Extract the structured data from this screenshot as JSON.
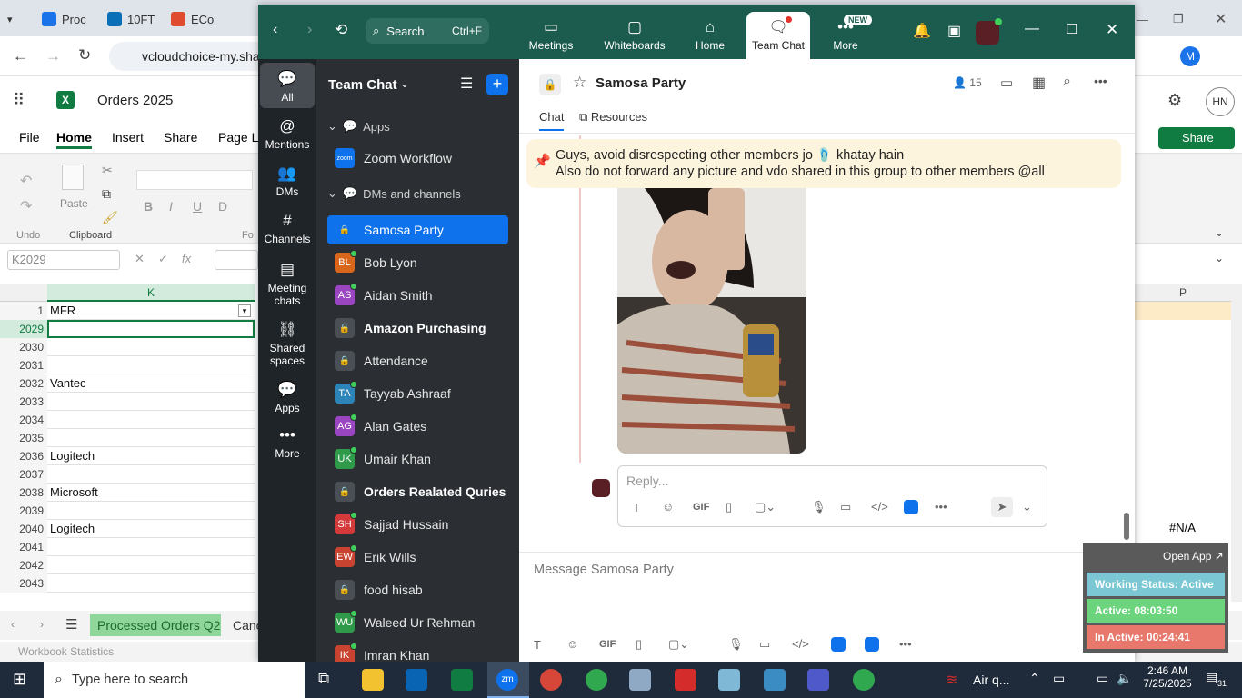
{
  "browser": {
    "tabs": [
      "Proc",
      "10FT",
      "ECo"
    ],
    "address": "vcloudchoice-my.sha"
  },
  "excel": {
    "title": "Orders 2025",
    "menu": [
      "File",
      "Home",
      "Insert",
      "Share",
      "Page La"
    ],
    "share_label": "Share",
    "ribbon": {
      "undo": "Undo",
      "paste": "Paste",
      "clipboard": "Clipboard",
      "font_partial": "Fo"
    },
    "name_box": "K2029",
    "col_k": "K",
    "col_p": "P",
    "header_row_num": "1",
    "header_cell": "MFR",
    "rows": [
      {
        "num": "2029",
        "k": ""
      },
      {
        "num": "2030",
        "k": ""
      },
      {
        "num": "2031",
        "k": ""
      },
      {
        "num": "2032",
        "k": "Vantec"
      },
      {
        "num": "2033",
        "k": ""
      },
      {
        "num": "2034",
        "k": ""
      },
      {
        "num": "2035",
        "k": ""
      },
      {
        "num": "2036",
        "k": "Logitech"
      },
      {
        "num": "2037",
        "k": ""
      },
      {
        "num": "2038",
        "k": "Microsoft"
      },
      {
        "num": "2039",
        "k": ""
      },
      {
        "num": "2040",
        "k": "Logitech"
      },
      {
        "num": "2041",
        "k": ""
      },
      {
        "num": "2042",
        "k": ""
      },
      {
        "num": "2043",
        "k": ""
      }
    ],
    "p_value": "#N/A",
    "sheet_tab": "Processed Orders Q2",
    "sheet_tab_next": "Canc",
    "status": "Workbook Statistics"
  },
  "zoom": {
    "search_label": "Search",
    "search_shortcut": "Ctrl+F",
    "nav": [
      "Meetings",
      "Whiteboards",
      "Home",
      "Team Chat",
      "More"
    ],
    "new_badge": "NEW",
    "rail": [
      "All",
      "Mentions",
      "DMs",
      "Channels",
      "Meeting chats",
      "Shared spaces",
      "Apps",
      "More"
    ],
    "panel_title": "Team Chat",
    "apps_section": "Apps",
    "apps_item": "Zoom Workflow",
    "apps_item_badge": "zoom",
    "dm_section": "DMs and channels",
    "list": [
      {
        "label": "Samosa Party",
        "initials": "",
        "color": "#0e72ed",
        "type": "lock"
      },
      {
        "label": "Bob Lyon",
        "initials": "BL",
        "color": "#d9671b",
        "type": "user"
      },
      {
        "label": "Aidan Smith",
        "initials": "AS",
        "color": "#9b46c1",
        "type": "user"
      },
      {
        "label": "Amazon Purchasing",
        "initials": "",
        "color": "#4a4f55",
        "type": "lock-bold"
      },
      {
        "label": "Attendance",
        "initials": "",
        "color": "#4a4f55",
        "type": "lock"
      },
      {
        "label": "Tayyab Ashraaf",
        "initials": "TA",
        "color": "#2c84b8",
        "type": "user"
      },
      {
        "label": "Alan Gates",
        "initials": "AG",
        "color": "#9b46c1",
        "type": "user"
      },
      {
        "label": "Umair Khan",
        "initials": "UK",
        "color": "#2f9a4a",
        "type": "user"
      },
      {
        "label": "Orders Realated Quries",
        "initials": "",
        "color": "#4a4f55",
        "type": "lock-bold"
      },
      {
        "label": "Sajjad Hussain",
        "initials": "SH",
        "color": "#d43a3a",
        "type": "user"
      },
      {
        "label": "Erik Wills",
        "initials": "EW",
        "color": "#c94430",
        "type": "user"
      },
      {
        "label": "food hisab",
        "initials": "",
        "color": "#4a4f55",
        "type": "lock"
      },
      {
        "label": "Waleed Ur Rehman",
        "initials": "WU",
        "color": "#2f9a4a",
        "type": "user"
      },
      {
        "label": "Imran Khan",
        "initials": "IK",
        "color": "#c94430",
        "type": "user"
      }
    ],
    "channel_title": "Samosa Party",
    "member_count": "15",
    "tab_chat": "Chat",
    "tab_resources": "Resources",
    "pinned_line1": "Guys, avoid disrespecting other members jo 🩴 khatay hain",
    "pinned_line2": "Also do not forward any picture and vdo shared in this group to other members @all",
    "reply_placeholder": "Reply...",
    "message_placeholder": "Message Samosa Party",
    "gif_label": "GIF"
  },
  "status_widget": {
    "open_app": "Open App ↗",
    "working": "Working Status: Active",
    "active": "Active: 08:03:50",
    "inactive": "In Active: 00:24:41"
  },
  "taskbar": {
    "search_placeholder": "Type here to search",
    "weather": "Air q...",
    "time": "2:46 AM",
    "date": "7/25/2025",
    "notif_count": "31"
  }
}
